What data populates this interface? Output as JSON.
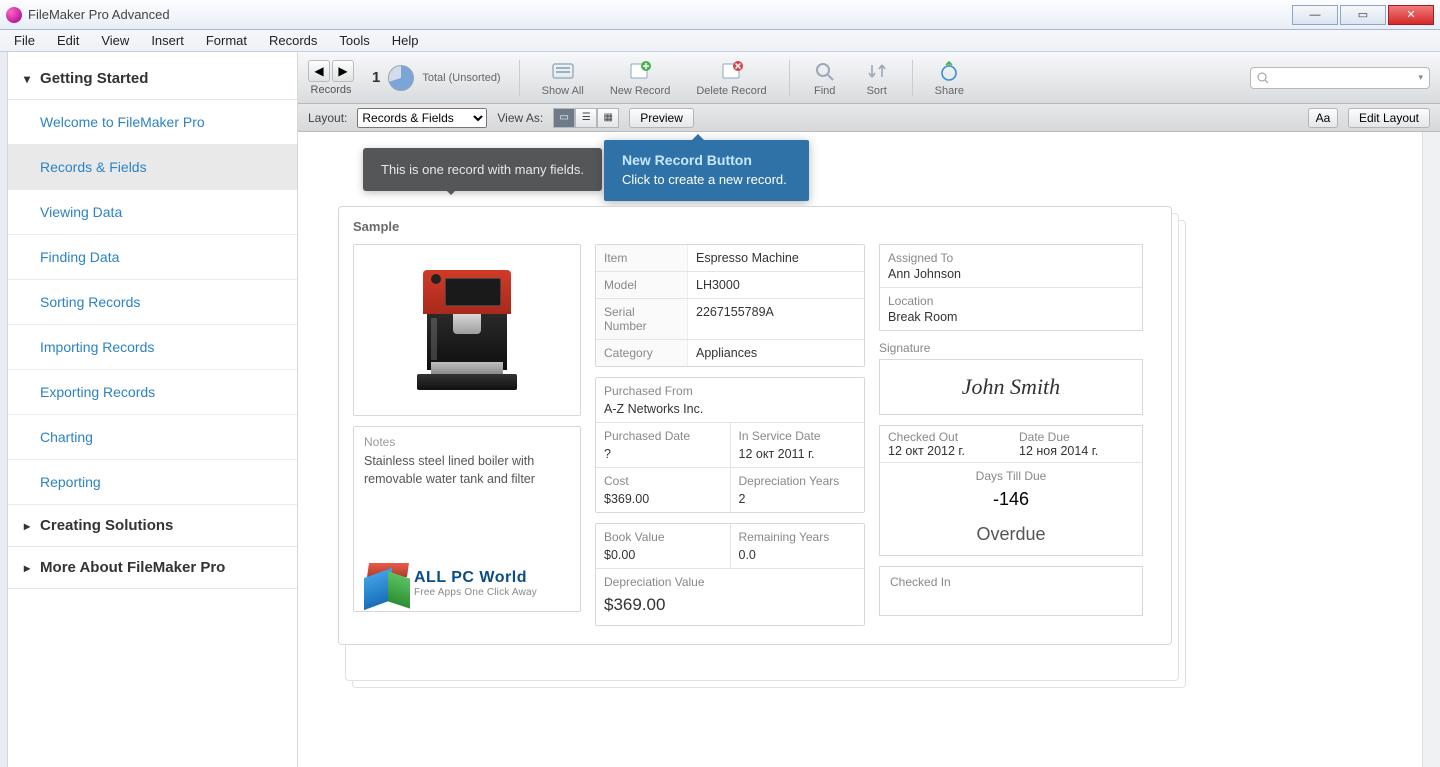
{
  "window": {
    "title": "FileMaker Pro Advanced"
  },
  "menu": [
    "File",
    "Edit",
    "View",
    "Insert",
    "Format",
    "Records",
    "Tools",
    "Help"
  ],
  "sidebar": {
    "sections": [
      {
        "title": "Getting Started",
        "expanded": true,
        "items": [
          "Welcome to FileMaker Pro",
          "Records & Fields",
          "Viewing Data",
          "Finding Data",
          "Sorting Records",
          "Importing Records",
          "Exporting Records",
          "Charting",
          "Reporting"
        ],
        "active_index": 1
      },
      {
        "title": "Creating Solutions",
        "expanded": false
      },
      {
        "title": "More About FileMaker Pro",
        "expanded": false
      }
    ]
  },
  "toolbar": {
    "records_label": "Records",
    "record_current": "1",
    "total_label": "Total (Unsorted)",
    "actions": {
      "show_all": "Show All",
      "new_record": "New Record",
      "delete_record": "Delete Record",
      "find": "Find",
      "sort": "Sort",
      "share": "Share"
    }
  },
  "subbar": {
    "layout_label": "Layout:",
    "layout_value": "Records & Fields",
    "view_as_label": "View As:",
    "preview": "Preview",
    "aa": "Aa",
    "edit_layout": "Edit Layout"
  },
  "tooltips": {
    "dark": "This is one record with many fields.",
    "blue_title": "New Record Button",
    "blue_body": "Click to create a new record."
  },
  "record": {
    "sample": "Sample",
    "notes_label": "Notes",
    "notes": "Stainless steel lined boiler with removable water tank and filter",
    "watermark_title": "ALL PC World",
    "watermark_sub": "Free Apps One Click Away",
    "item_l": "Item",
    "item": "Espresso Machine",
    "model_l": "Model",
    "model": "LH3000",
    "serial_l": "Serial Number",
    "serial": "2267155789A",
    "category_l": "Category",
    "category": "Appliances",
    "purchased_from_l": "Purchased From",
    "purchased_from": "A-Z Networks Inc.",
    "purchased_date_l": "Purchased Date",
    "purchased_date": "?",
    "in_service_l": "In Service Date",
    "in_service": "12 окт 2011 г.",
    "cost_l": "Cost",
    "cost": "$369.00",
    "dep_years_l": "Depreciation Years",
    "dep_years": "2",
    "book_value_l": "Book Value",
    "book_value": "$0.00",
    "rem_years_l": "Remaining Years",
    "rem_years": "0.0",
    "dep_value_l": "Depreciation Value",
    "dep_value": "$369.00",
    "assigned_l": "Assigned To",
    "assigned": "Ann Johnson",
    "location_l": "Location",
    "location": "Break Room",
    "signature_l": "Signature",
    "signature": "John Smith",
    "checked_out_l": "Checked Out",
    "checked_out": "12 окт 2012 г.",
    "date_due_l": "Date Due",
    "date_due": "12 ноя 2014 г.",
    "days_till_l": "Days Till Due",
    "days_till": "-146",
    "overdue": "Overdue",
    "checked_in_l": "Checked In"
  }
}
